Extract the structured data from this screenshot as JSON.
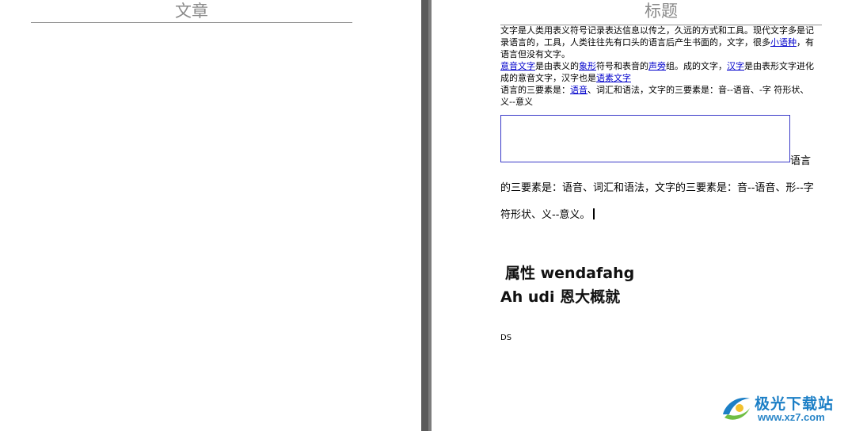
{
  "left_page": {
    "title": "文章"
  },
  "right_page": {
    "title": "标题",
    "paragraphs": [
      [
        {
          "t": "文字是人类用表义符号记录表达信息以传之，久远的方式和工具。现代文字多是记录语言的，工具，人类往往先有口头的语言后产生书面的，文字，很多"
        },
        {
          "t": "小语种",
          "link": true
        },
        {
          "t": "，有语言但没有文字。"
        }
      ],
      [
        {
          "t": "意音文字",
          "link": true
        },
        {
          "t": "是由表义的"
        },
        {
          "t": "象形",
          "link": true
        },
        {
          "t": "符号和表音的"
        },
        {
          "t": "声旁",
          "link": true
        },
        {
          "t": "组。成的文字，"
        },
        {
          "t": "汉字",
          "link": true
        },
        {
          "t": "是由表形文字进化成的意音文字，汉字也是"
        },
        {
          "t": "语素文字",
          "link": true
        }
      ],
      [
        {
          "t": "语言的三要素是："
        },
        {
          "t": "语音",
          "link": true
        },
        {
          "t": "、词汇和语法，文字的三要素是：音--语音、-字 符形状、义--意义"
        }
      ]
    ],
    "large_paragraph": "语言的三要素是：语音、词汇和语法，文字的三要素是：音--语音、形--字符形状、义--意义。",
    "heading_line1": "属性 wendafahg",
    "heading_line2": "Ah udi 恩大概就",
    "small_label": "DS"
  },
  "watermark": {
    "title": "极光下载站",
    "url": "www.xz7.com",
    "colors": {
      "blue": "#1c7fc6",
      "green": "#6fbe44"
    }
  },
  "colors": {
    "link": "#0000cc",
    "heading_gray": "#8a8a8a",
    "gutter": "#5a5a5a",
    "textbox_border": "#3a3ac8"
  }
}
